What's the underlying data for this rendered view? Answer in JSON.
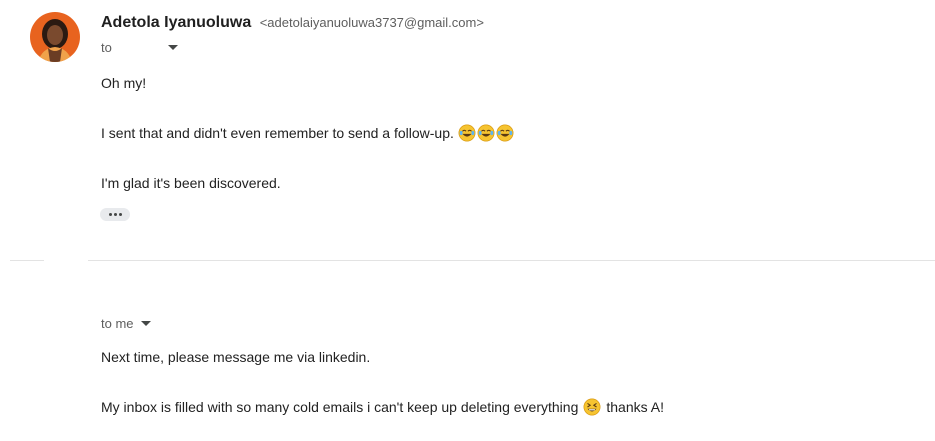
{
  "message1": {
    "sender_name": "Adetola Iyanuoluwa",
    "sender_email": "<adetolaiyanuoluwa3737@gmail.com>",
    "to_label": "to",
    "lines": [
      "Oh my!",
      "I sent that and didn't even remember to send a follow-up.",
      "I'm glad it's been discovered."
    ],
    "line2_emoji": "face-with-tears-of-joy-icon x3",
    "more_icon": "ellipsis-icon"
  },
  "message2": {
    "to_label": "to me",
    "lines": [
      "Next time, please message me via linkedin.",
      "My inbox is filled with so many cold emails i can't keep up deleting everything",
      "thanks A!"
    ],
    "line2_emoji": "grinning-squinting-face-icon"
  },
  "colors": {
    "avatar_bg": "#e8631f",
    "text": "#222222",
    "meta": "#5e5e5e",
    "divider": "#e3e3e3"
  }
}
